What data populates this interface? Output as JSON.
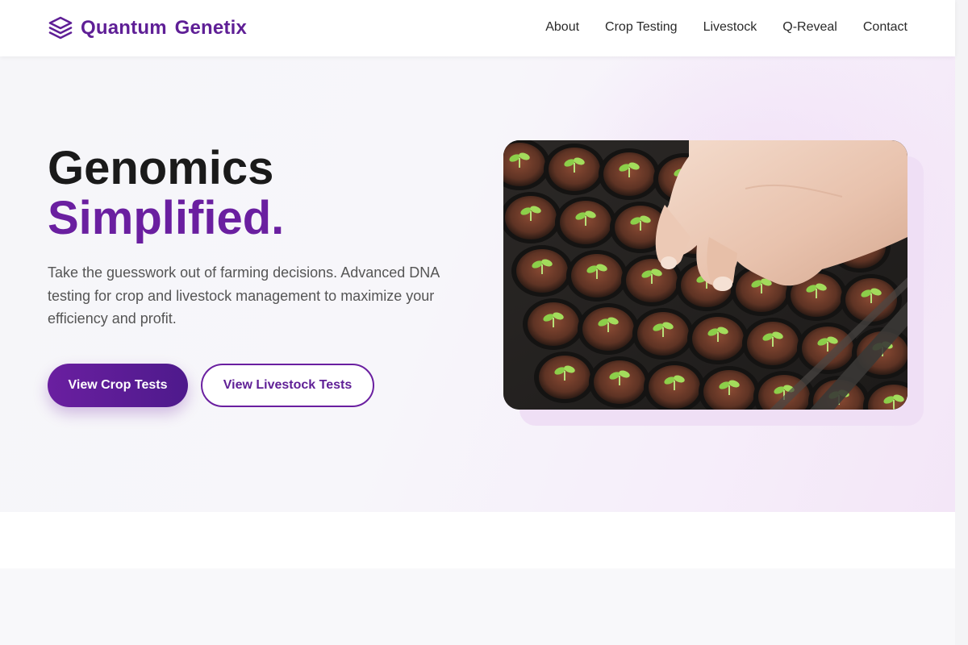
{
  "brand": {
    "name": "Quantum Genetix",
    "logo_icon": "layers-icon",
    "accent_color": "#6a1fa0"
  },
  "nav": {
    "items": [
      {
        "label": "About"
      },
      {
        "label": "Crop Testing"
      },
      {
        "label": "Livestock"
      },
      {
        "label": "Q-Reveal"
      },
      {
        "label": "Contact"
      }
    ]
  },
  "hero": {
    "title_line1": "Genomics",
    "title_line2": "Simplified.",
    "description": "Take the guesswork out of farming decisions. Advanced DNA testing for crop and livestock management to maximize your efficiency and profit.",
    "primary_button": "View Crop Tests",
    "secondary_button": "View Livestock Tests",
    "image_subject": "seedling-tray-photo"
  }
}
